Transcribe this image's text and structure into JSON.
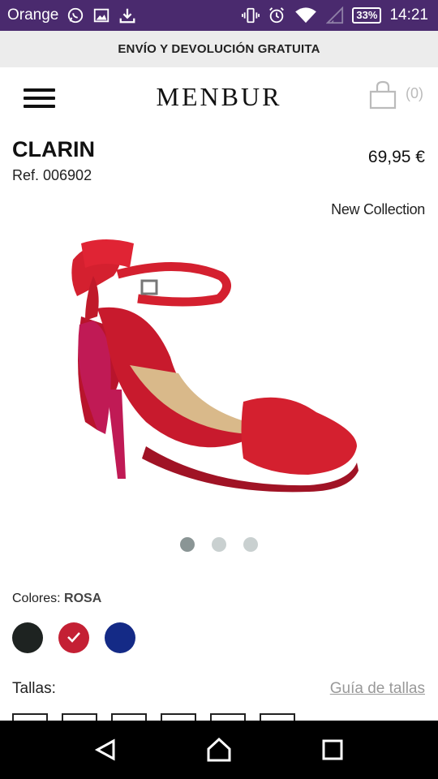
{
  "status_bar": {
    "carrier": "Orange",
    "battery": "33%",
    "time": "14:21",
    "icons": [
      "whatsapp-icon",
      "image-icon",
      "download-icon",
      "vibrate-icon",
      "alarm-icon",
      "wifi-icon",
      "signal-icon",
      "battery-icon"
    ]
  },
  "banner": {
    "text": "ENVÍO Y DEVOLUCIÓN GRATUITA"
  },
  "header": {
    "logo": "MENBUR",
    "cart_count": "(0)"
  },
  "product": {
    "name": "CLARIN",
    "ref": "Ref. 006902",
    "price": "69,95 €",
    "badge": "New Collection",
    "carousel": {
      "total": 3,
      "active": 1
    }
  },
  "colors": {
    "label": "Colores:",
    "selected_name": "ROSA",
    "swatches": [
      {
        "name": "black",
        "hex": "#1e2321",
        "selected": false
      },
      {
        "name": "rosa",
        "hex": "#c42034",
        "selected": true
      },
      {
        "name": "blue",
        "hex": "#142a86",
        "selected": false
      }
    ]
  },
  "sizes": {
    "label": "Tallas:",
    "guide_link": "Guía de tallas"
  },
  "nav_bar": {
    "icons": [
      "back-icon",
      "home-icon",
      "recents-icon"
    ]
  },
  "colors_theme": {
    "status_bar_bg": "#4a2a6e",
    "banner_bg": "#ececec",
    "shoe_red": "#d4202f"
  }
}
